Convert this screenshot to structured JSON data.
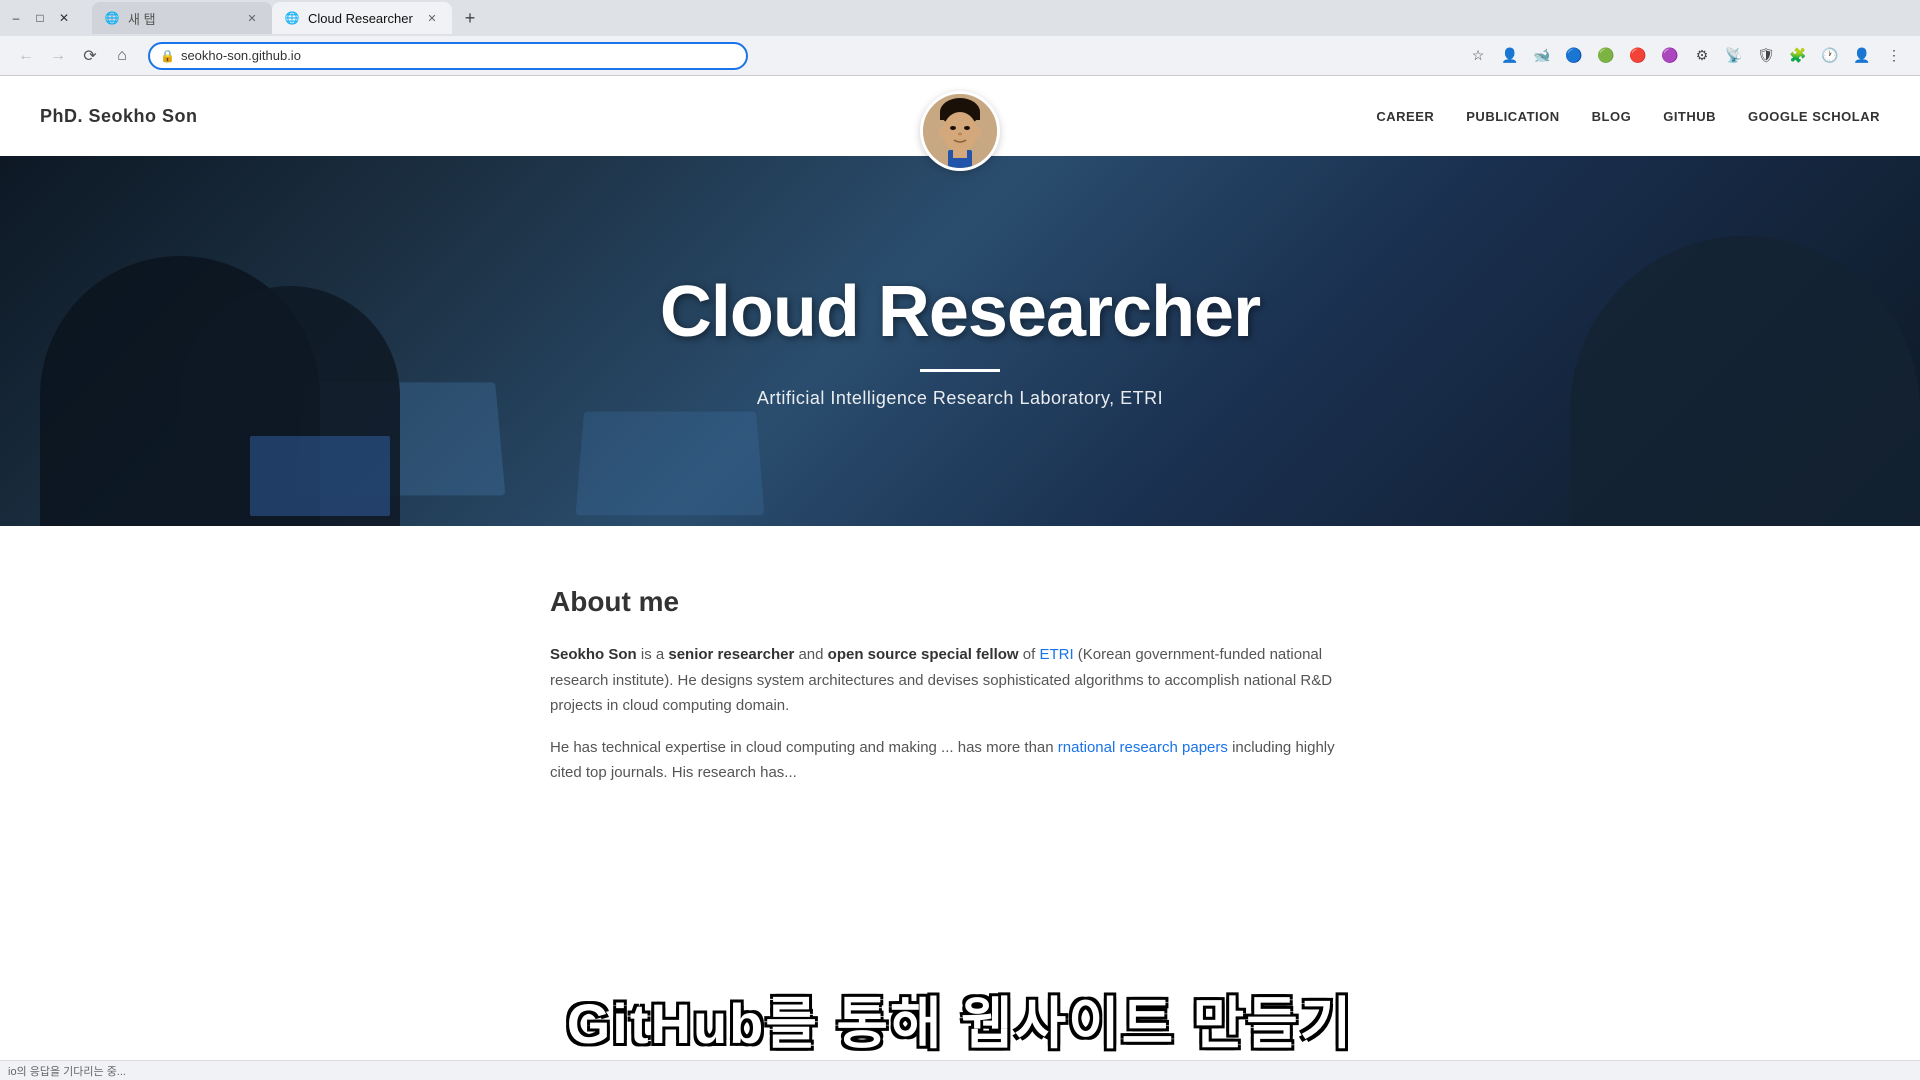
{
  "browser": {
    "tabs": [
      {
        "id": "tab-new",
        "label": "새 탭",
        "active": false,
        "favicon": "🌐"
      },
      {
        "id": "tab-cloud-researcher",
        "label": "Cloud Researcher",
        "active": true,
        "favicon": "🌐"
      }
    ],
    "add_tab_label": "+",
    "nav": {
      "back_title": "뒤로",
      "forward_title": "앞으로",
      "reload_title": "새로고침",
      "home_title": "홈"
    },
    "address": "seokho-son.github.io",
    "address_protocol": "https",
    "toolbar_icons": [
      "bookmark-star",
      "profile",
      "naver-whale",
      "extensions",
      "settings",
      "sync",
      "extensions2",
      "rss",
      "adblock",
      "papago",
      "clova",
      "history",
      "avatar"
    ]
  },
  "site": {
    "logo": "PhD. Seokho Son",
    "nav_links": [
      {
        "label": "CAREER",
        "href": "#career"
      },
      {
        "label": "PUBLICATION",
        "href": "#publication"
      },
      {
        "label": "BLOG",
        "href": "#blog"
      },
      {
        "label": "GITHUB",
        "href": "#github"
      },
      {
        "label": "GOOGLE SCHOLAR",
        "href": "#googlescholar"
      }
    ],
    "hero": {
      "title": "Cloud Researcher",
      "divider": true,
      "subtitle": "Artificial Intelligence Research Laboratory, ETRI"
    },
    "about": {
      "section_title": "About me",
      "paragraphs": [
        {
          "html_parts": [
            {
              "type": "strong",
              "text": "Seokho Son"
            },
            {
              "type": "text",
              "text": " is a "
            },
            {
              "type": "strong",
              "text": "senior researcher"
            },
            {
              "type": "text",
              "text": " and "
            },
            {
              "type": "strong",
              "text": "open source special fellow"
            },
            {
              "type": "text",
              "text": " of "
            },
            {
              "type": "link",
              "text": "ETRI"
            },
            {
              "type": "text",
              "text": " (Korean government-funded national research institute). He designs system architectures and devises sophisticated algorithms to accomplish national R&D projects in cloud computing domain."
            }
          ]
        },
        {
          "partial": true,
          "html_parts": [
            {
              "type": "text",
              "text": "He has technical expertise in cloud ... making ... has more than ... rnational research papers including highly cited top journals. His research has ..."
            }
          ]
        }
      ]
    }
  },
  "overlay": {
    "korean_text": "GitHub를 통해 웹사이트 만들기"
  },
  "status_bar": {
    "loading_text": "io의 응답을 기다리는 중..."
  }
}
